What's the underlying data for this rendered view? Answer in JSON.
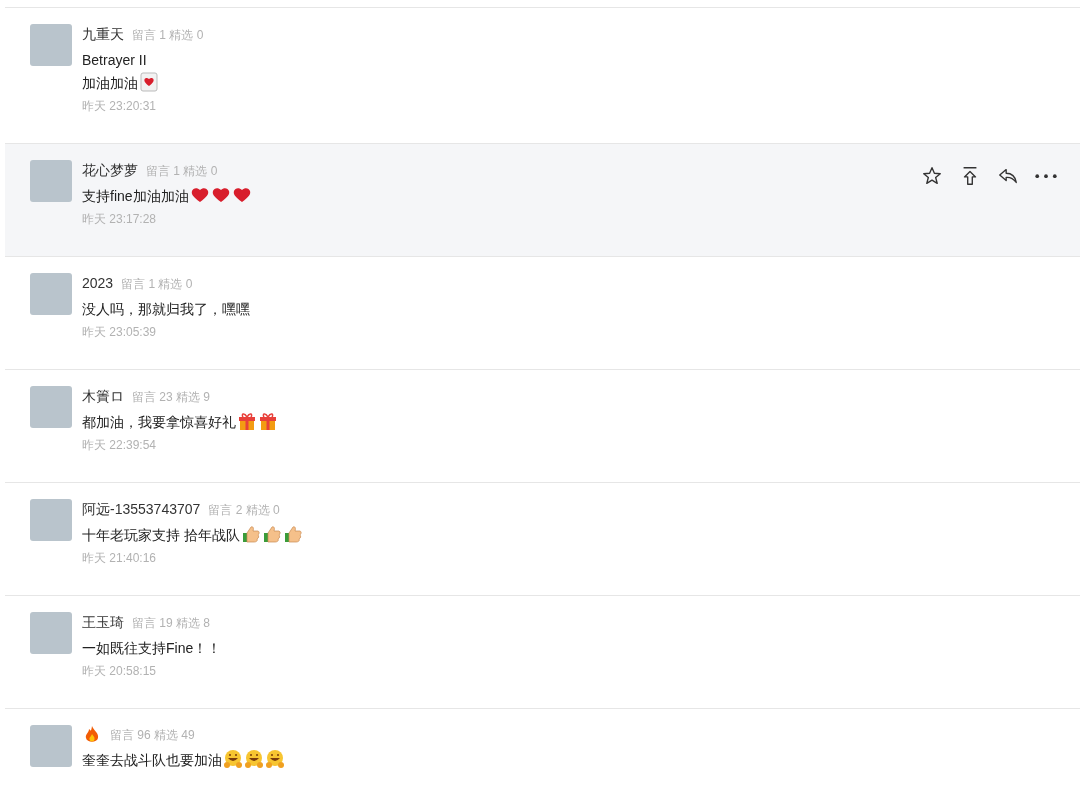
{
  "comments": [
    {
      "name": "九重天",
      "stats": "留言 1 精选 0",
      "lines": [
        "Betrayer II",
        "加油加油"
      ],
      "emojis": [
        {
          "kind": "boxed-heart"
        }
      ],
      "time": "昨天 23:20:31",
      "hovered": false
    },
    {
      "name": "花心梦萝",
      "stats": "留言 1 精选 0",
      "lines": [
        "支持fine加油加油"
      ],
      "emojis": [
        {
          "kind": "heart"
        },
        {
          "kind": "heart"
        },
        {
          "kind": "heart"
        }
      ],
      "time": "昨天 23:17:28",
      "hovered": true
    },
    {
      "name": "2023",
      "stats": "留言 1 精选 0",
      "lines": [
        "没人吗，那就归我了，嘿嘿"
      ],
      "time": "昨天 23:05:39",
      "hovered": false
    },
    {
      "name": "木簀ロ",
      "stats": "留言 23 精选 9",
      "lines": [
        "都加油，我要拿惊喜好礼"
      ],
      "emojis": [
        {
          "kind": "gift"
        },
        {
          "kind": "gift"
        }
      ],
      "time": "昨天 22:39:54",
      "hovered": false
    },
    {
      "name": "阿远-13553743707",
      "stats": "留言 2 精选 0",
      "lines": [
        "十年老玩家支持  拾年战队"
      ],
      "emojis": [
        {
          "kind": "thumb"
        },
        {
          "kind": "thumb"
        },
        {
          "kind": "thumb"
        }
      ],
      "time": "昨天 21:40:16",
      "hovered": false
    },
    {
      "name": "王玉琦",
      "stats": "留言 19 精选 8",
      "lines": [
        "一如既往支持Fine！！"
      ],
      "time": "昨天 20:58:15",
      "hovered": false
    },
    {
      "name_icon": {
        "kind": "fire"
      },
      "stats": "留言 96 精选 49",
      "lines": [
        "奎奎去战斗队也要加油"
      ],
      "emojis": [
        {
          "kind": "grin"
        },
        {
          "kind": "grin"
        },
        {
          "kind": "grin"
        }
      ],
      "hovered": false
    }
  ]
}
